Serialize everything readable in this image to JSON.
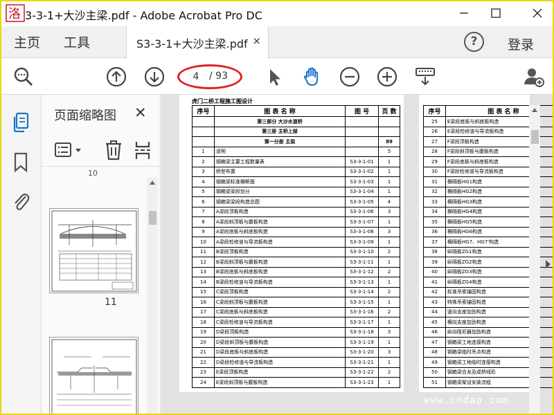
{
  "window": {
    "title": "S3-3-1+大沙主梁.pdf - Adobe Acrobat Pro DC",
    "title_visible": "3-3-1+大沙主梁.pdf - Adobe Acrobat Pro DC",
    "logo_text": "洛"
  },
  "menubar": {
    "home": "主页",
    "tools": "工具",
    "login": "登录",
    "help_glyph": "?"
  },
  "doc_tab": {
    "label": "S3-3-1+大沙主梁.pdf",
    "close": "×"
  },
  "toolbar": {
    "page_current": "4",
    "page_total": "/ 93"
  },
  "thumb_panel": {
    "title": "页面缩略图",
    "close": "✕",
    "label_prev": "10",
    "label_11": "11"
  },
  "document": {
    "caption": "虎门二桥工程施工图设计",
    "headers": [
      "序号",
      "图 表 名 称",
      "图  号",
      "页 数"
    ],
    "sections": [
      {
        "name": "第三部分  大沙水道桥"
      },
      {
        "name": "第三册  主桥上部"
      },
      {
        "name": "第一分册  主梁",
        "pages": "89"
      }
    ],
    "rows": [
      {
        "no": "1",
        "name": "说明",
        "fig": "",
        "pages": "5"
      },
      {
        "no": "2",
        "name": "钢箱梁主要工程数量表",
        "fig": "S3-3-1-01",
        "pages": "1"
      },
      {
        "no": "3",
        "name": "桥型布置",
        "fig": "S3-3-1-02",
        "pages": "1"
      },
      {
        "no": "4",
        "name": "钢箱梁标准横断面",
        "fig": "S3-3-1-03",
        "pages": "1"
      },
      {
        "no": "5",
        "name": "钢箱梁梁段划分",
        "fig": "S3-3-1-04",
        "pages": "1"
      },
      {
        "no": "6",
        "name": "钢箱梁梁段构造总图",
        "fig": "S3-3-1-05",
        "pages": "4"
      },
      {
        "no": "7",
        "name": "A梁段顶板构造",
        "fig": "S3-3-1-06",
        "pages": "3"
      },
      {
        "no": "8",
        "name": "A梁段斜顶板与腹板构造",
        "fig": "S3-3-1-07",
        "pages": "1"
      },
      {
        "no": "9",
        "name": "A梁段底板与斜底板构造",
        "fig": "S3-3-1-08",
        "pages": "3"
      },
      {
        "no": "10",
        "name": "A梁段检修道与导流板构造",
        "fig": "S3-3-1-09",
        "pages": "1"
      },
      {
        "no": "11",
        "name": "B梁段顶板构造",
        "fig": "S3-3-1-10",
        "pages": "2"
      },
      {
        "no": "12",
        "name": "B梁段斜顶板与腹板构造",
        "fig": "S3-3-1-11",
        "pages": "1"
      },
      {
        "no": "13",
        "name": "B梁段底板与斜底板构造",
        "fig": "S3-3-1-12",
        "pages": "2"
      },
      {
        "no": "14",
        "name": "B梁段检修道与导流板构造",
        "fig": "S3-3-1-13",
        "pages": "1"
      },
      {
        "no": "15",
        "name": "C梁段顶板构造",
        "fig": "S3-3-1-14",
        "pages": "2"
      },
      {
        "no": "16",
        "name": "C梁段斜顶板与腹板构造",
        "fig": "S3-3-1-15",
        "pages": "1"
      },
      {
        "no": "17",
        "name": "C梁段底板与斜底板构造",
        "fig": "S3-3-1-16",
        "pages": "2"
      },
      {
        "no": "18",
        "name": "C梁段检修道与导流板构造",
        "fig": "S3-3-1-17",
        "pages": "1"
      },
      {
        "no": "19",
        "name": "D梁段顶板构造",
        "fig": "S3-3-1-18",
        "pages": "3"
      },
      {
        "no": "20",
        "name": "D梁段斜顶板与腹板构造",
        "fig": "S3-3-1-19",
        "pages": "1"
      },
      {
        "no": "21",
        "name": "D梁段底板与斜底板构造",
        "fig": "S3-3-1-20",
        "pages": "3"
      },
      {
        "no": "22",
        "name": "D梁段检修道与导流板构造",
        "fig": "S3-3-1-21",
        "pages": "1"
      },
      {
        "no": "23",
        "name": "E梁段顶板构造",
        "fig": "S3-3-1-22",
        "pages": "2"
      },
      {
        "no": "24",
        "name": "E梁段斜顶板与腹板构造",
        "fig": "S3-3-1-23",
        "pages": "1"
      }
    ],
    "right_headers": [
      "序号",
      "图 表 名 称"
    ],
    "right_rows": [
      {
        "no": "25",
        "name": "E梁段底板与斜底板构造"
      },
      {
        "no": "26",
        "name": "E梁段检修道与导流板构造"
      },
      {
        "no": "27",
        "name": "F梁段顶板构造"
      },
      {
        "no": "28",
        "name": "F梁段斜顶板与腹板构造"
      },
      {
        "no": "29",
        "name": "F梁段底板与斜底板构造"
      },
      {
        "no": "30",
        "name": "F梁段检修道与导流板构造"
      },
      {
        "no": "31",
        "name": "横隔板HG1构造"
      },
      {
        "no": "32",
        "name": "横隔板HG2构造"
      },
      {
        "no": "33",
        "name": "横隔板HG3构造"
      },
      {
        "no": "34",
        "name": "横隔板HG4构造"
      },
      {
        "no": "35",
        "name": "横隔板HG5构造"
      },
      {
        "no": "36",
        "name": "横隔板HG6构造"
      },
      {
        "no": "37",
        "name": "横隔板HG7、HG7'构造"
      },
      {
        "no": "38",
        "name": "纵隔板ZG1构造"
      },
      {
        "no": "39",
        "name": "纵隔板ZG2构造"
      },
      {
        "no": "40",
        "name": "纵隔板ZG3构造"
      },
      {
        "no": "41",
        "name": "纵隔板ZG4构造"
      },
      {
        "no": "42",
        "name": "标准吊索锚固构造"
      },
      {
        "no": "43",
        "name": "特殊吊索锚固构造"
      },
      {
        "no": "44",
        "name": "竖向支座加劲构造"
      },
      {
        "no": "45",
        "name": "横向支座加劲构造"
      },
      {
        "no": "46",
        "name": "纵向阻尼器加劲构造"
      },
      {
        "no": "47",
        "name": "钢箱梁工地连接构造"
      },
      {
        "no": "48",
        "name": "钢箱梁临时吊点构造"
      },
      {
        "no": "49",
        "name": "钢箱梁工地临时连接构造"
      },
      {
        "no": "50",
        "name": "钢箱梁合龙及成桥线形"
      },
      {
        "no": "51",
        "name": "钢箱梁架设安装流程"
      }
    ]
  },
  "watermark": "www.cndao.com",
  "colors": {
    "accent": "#1a73c8",
    "annotation": "#e02020",
    "frame": "#e8d800"
  }
}
